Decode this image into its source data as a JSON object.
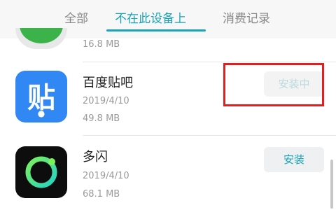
{
  "tabs": [
    {
      "label": "全部",
      "active": false
    },
    {
      "label": "不在此设备上",
      "active": true
    },
    {
      "label": "消费记录",
      "active": false
    }
  ],
  "accent_color": "#1aa3b5",
  "partial_item": {
    "size": "16.8 MB",
    "icon": "green-app-icon"
  },
  "apps": [
    {
      "name": "百度贴吧",
      "date": "2019/4/10",
      "size": "49.8 MB",
      "button": "安装中",
      "icon": "tieba-icon",
      "icon_glyph": "贴",
      "highlighted": true
    },
    {
      "name": "多闪",
      "date": "2019/4/10",
      "size": "68.1 MB",
      "button": "安装",
      "icon": "duoshan-icon"
    }
  ]
}
